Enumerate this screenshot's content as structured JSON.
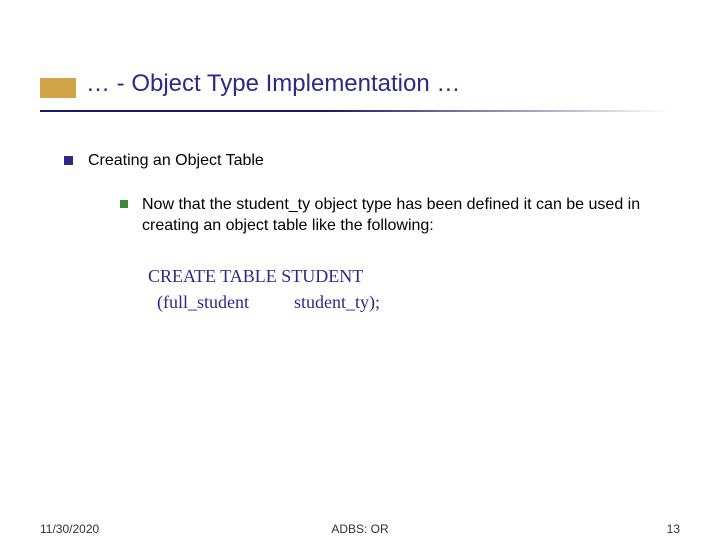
{
  "title": "… - Object Type Implementation …",
  "bullets": {
    "lvl1": "Creating an Object Table",
    "lvl2": "Now that the student_ty object type has been defined it can be used in creating an object table like the following:"
  },
  "code": {
    "line1": "CREATE TABLE STUDENT",
    "line2": "  (full_student          student_ty);"
  },
  "footer": {
    "date": "11/30/2020",
    "center": "ADBS: OR",
    "page": "13"
  }
}
